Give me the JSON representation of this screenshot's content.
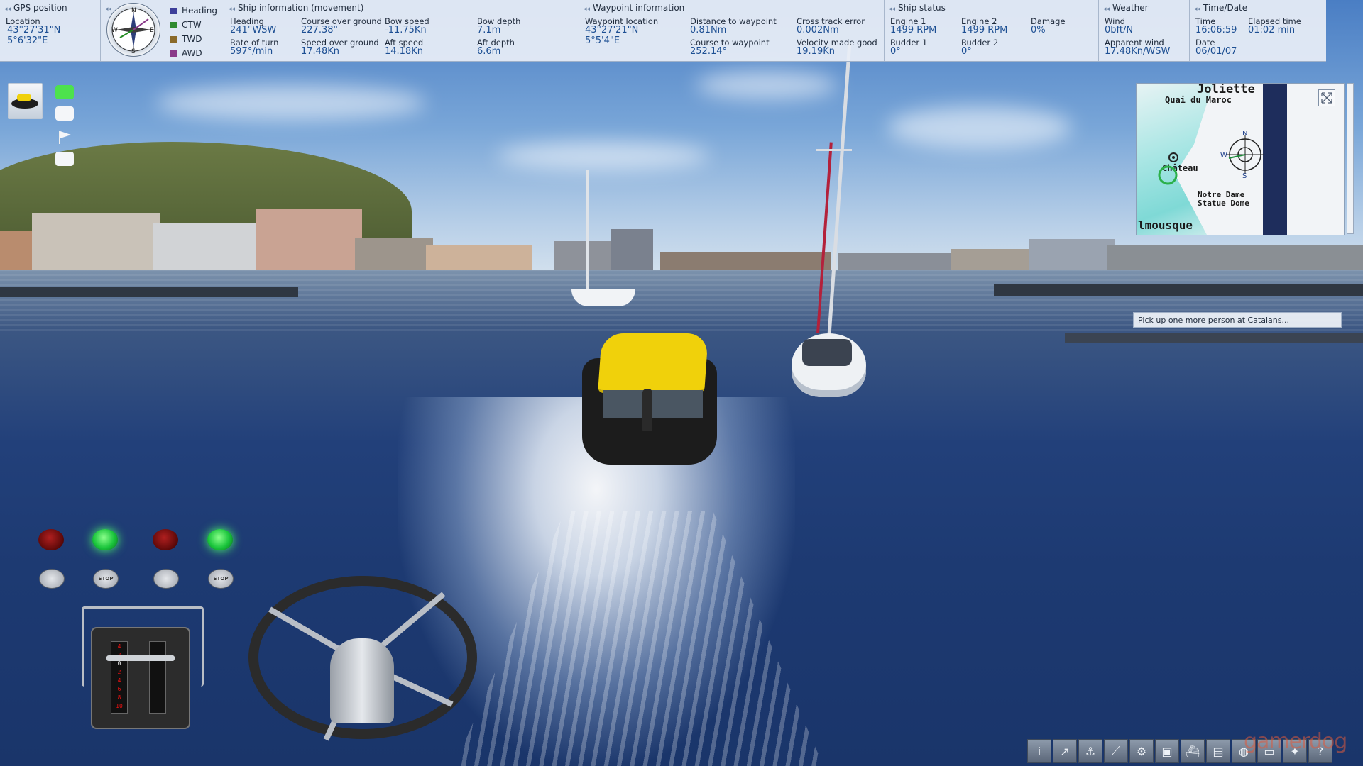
{
  "gps": {
    "title": "GPS position",
    "location_label": "Location",
    "lat": "43°27'31\"N",
    "lon": "5°6'32\"E"
  },
  "compass": {
    "letters": [
      "N",
      "E",
      "S",
      "W"
    ],
    "legend": [
      {
        "label": "Heading",
        "color": "#3d3f9a"
      },
      {
        "label": "CTW",
        "color": "#2f8a2f"
      },
      {
        "label": "TWD",
        "color": "#8a6a2a"
      },
      {
        "label": "AWD",
        "color": "#8a3a8a"
      }
    ]
  },
  "movement": {
    "title": "Ship information (movement)",
    "heading_label": "Heading",
    "heading": "241°WSW",
    "rate_label": "Rate of turn",
    "rate": "597°/min",
    "cog_label": "Course over ground",
    "cog": "227.38°",
    "sog_label": "Speed over ground",
    "sog": "17.48Kn",
    "bow_speed_label": "Bow speed",
    "bow_speed": "-11.75Kn",
    "aft_speed_label": "Aft speed",
    "aft_speed": "14.18Kn",
    "bow_depth_label": "Bow depth",
    "bow_depth": "7.1m",
    "aft_depth_label": "Aft depth",
    "aft_depth": "6.6m"
  },
  "waypoint": {
    "title": "Waypoint information",
    "loc_label": "Waypoint location",
    "lat": "43°27'21\"N",
    "lon": "5°5'4\"E",
    "dist_label": "Distance to waypoint",
    "dist": "0.81Nm",
    "ctw_label": "Course to waypoint",
    "ctw": "252.14°",
    "xte_label": "Cross track error",
    "xte": "0.002Nm",
    "vmg_label": "Velocity made good",
    "vmg": "19.19Kn"
  },
  "status": {
    "title": "Ship status",
    "engine1_label": "Engine 1",
    "engine1": "1499 RPM",
    "engine2_label": "Engine 2",
    "engine2": "1499 RPM",
    "damage_label": "Damage",
    "damage": "0%",
    "rudder1_label": "Rudder 1",
    "rudder1": "0°",
    "rudder2_label": "Rudder 2",
    "rudder2": "0°"
  },
  "weather": {
    "title": "Weather",
    "wind_label": "Wind",
    "wind": "0bft/N",
    "apparent_label": "Apparent wind",
    "apparent": "17.48Kn/WSW"
  },
  "time": {
    "title": "Time/Date",
    "time_label": "Time",
    "time": "16:06:59",
    "elapsed_label": "Elapsed time",
    "elapsed": "01:02 min",
    "date_label": "Date",
    "date": "06/01/07"
  },
  "minimap": {
    "labels": {
      "joliette": "Joliette",
      "quai": "Quai du Maroc",
      "chateau": "Château",
      "notre_dame": "Notre Dame",
      "statue": "Statue Dome",
      "mousque": "lmousque"
    },
    "compass_n": "N",
    "compass_s": "S",
    "compass_w": "W"
  },
  "mission": {
    "text": "Pick up one more person at Catalans..."
  },
  "engine_controls": {
    "stop_label": "STOP",
    "throttle_scale": [
      "4",
      "2",
      "0",
      "2",
      "4",
      "6",
      "8",
      "10"
    ]
  },
  "toolbar": {
    "buttons": [
      {
        "name": "info-icon",
        "glyph": "i"
      },
      {
        "name": "route-icon",
        "glyph": "↗"
      },
      {
        "name": "chart-icon",
        "glyph": "⚓"
      },
      {
        "name": "rope-icon",
        "glyph": "⟋"
      },
      {
        "name": "crane-icon",
        "glyph": "⚙"
      },
      {
        "name": "screen-icon",
        "glyph": "▣"
      },
      {
        "name": "ship-icon",
        "glyph": "⛴"
      },
      {
        "name": "panel-icon",
        "glyph": "▤"
      },
      {
        "name": "radar-icon",
        "glyph": "◍"
      },
      {
        "name": "camera-icon",
        "glyph": "▭"
      },
      {
        "name": "settings-icon",
        "glyph": "✦"
      },
      {
        "name": "help-icon",
        "glyph": "?"
      }
    ]
  },
  "watermark": "gamerdog"
}
